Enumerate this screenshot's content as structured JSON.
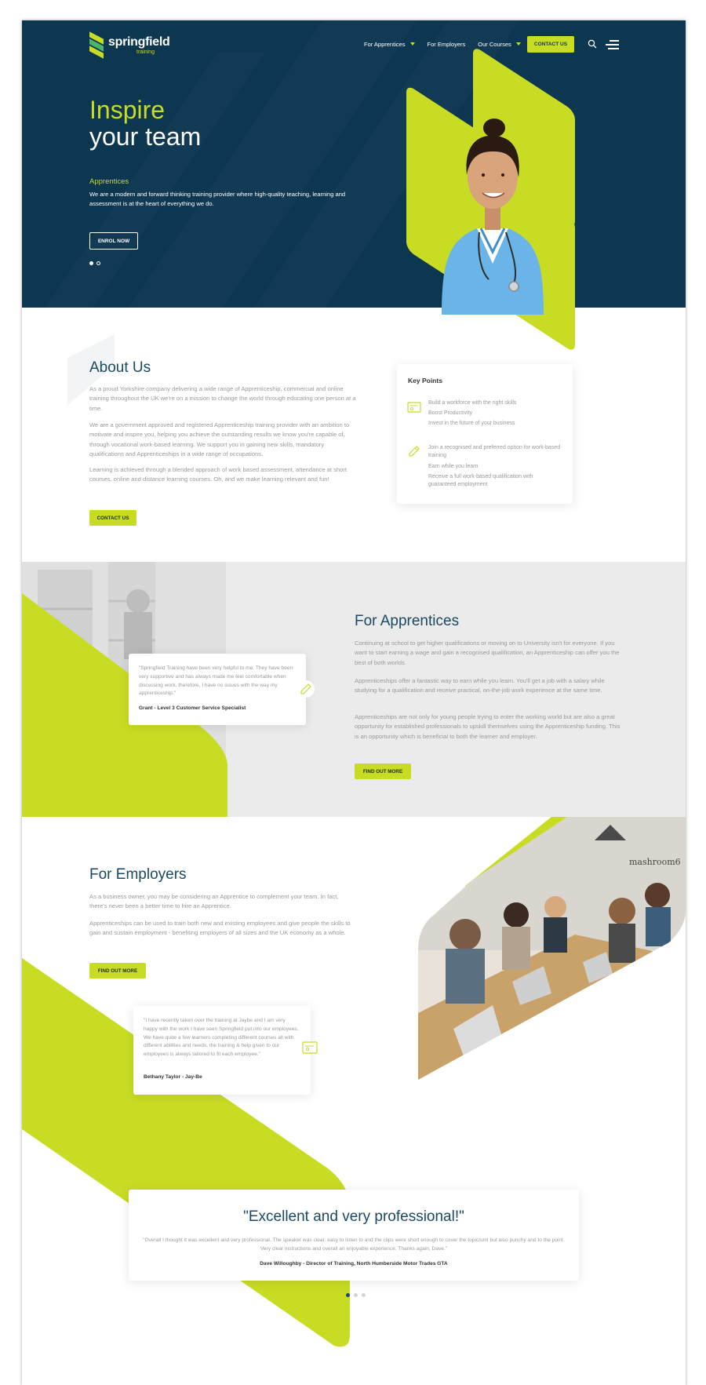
{
  "brand": {
    "name": "springfield",
    "sub": "training",
    "accent": "#c9dc24",
    "navy": "#0d3650",
    "heading": "#1a4a63"
  },
  "nav": {
    "items": [
      {
        "label": "For Apprentices",
        "dropdown": true
      },
      {
        "label": "For Employers",
        "dropdown": false
      },
      {
        "label": "Our Courses",
        "dropdown": true
      }
    ],
    "contact_label": "CONTACT US",
    "icons": [
      "search-icon",
      "menu-icon"
    ]
  },
  "hero": {
    "line1": "Inspire",
    "line2": "your team",
    "subtitle": "Apprentices",
    "description": "We are a modern and forward thinking training provider where high-quality teaching, learning and assessment is at the heart of everything we do.",
    "cta": "ENROL NOW",
    "slides": 2,
    "active_slide": 1
  },
  "about": {
    "title": "About Us",
    "p1": "As a proud Yorkshire company delivering a wide range of Apprenticeship, commercial and online training throughout the UK we're on a mission to change the world through educating one person at a time.",
    "p2": "We are a government approved and registered Apprenticeship training provider with an ambition to motivate and inspire you, helping you achieve the outstanding results we know you're capable of, through vocational work-based learning. We support you in gaining new skills, mandatory qualifications and Apprenticeships in a wide range of occupations.",
    "p3": "Learning is achieved through a blended approach of work based assessment, attendance at short courses, online and distance learning courses. Oh, and we make learning relevant and fun!",
    "cta": "CONTACT US"
  },
  "key_points": {
    "title": "Key Points",
    "group1": [
      "Build a workforce with the right skills",
      "Boost Productivity",
      "Invest in the future of your business"
    ],
    "group2": [
      "Join a recognised and preferred option for work-based training",
      "Earn while you learn",
      "Receive a full work-based qualification with guaranteed employment"
    ],
    "icons": [
      "certificate-icon",
      "pencil-icon"
    ]
  },
  "apprentices": {
    "title": "For Apprentices",
    "p1": "Continuing at school to get higher qualifications or moving on to University isn't for everyone. If you want to start earning a wage and gain a recognised qualification, an Apprenticeship can offer you the best of both worlds.",
    "p2": "Apprenticeships offer a fantastic way to earn while you learn. You'll get a job with a salary while studying for a qualification and receive practical, on-the-job work experience at the same time.",
    "p3": "Apprenticeships are not only for young people trying to enter the working world but are also a great opportunity for established professionals to upskill themselves using the Apprenticeship funding. This is an opportunity which is beneficial to both the learner and employer.",
    "cta": "FIND OUT MORE",
    "quote": "\"Springfield Training have been very helpful to me. They have been very supportive and has always made me feel comfortable when discussing work, therefore, I have no issues with the way my apprenticeship.\"",
    "quote_author": "Grant - Level 3 Customer Service Specialist"
  },
  "employers": {
    "title": "For Employers",
    "p1": "As a business owner, you may be considering an Apprentice to complement your team. In fact, there's never been a better time to hire an Apprentice.",
    "p2": "Apprenticeships can be used to train both new and existing employees and give people the skills to gain and sustain employment - benefiting employers of all sizes and the UK economy as a whole.",
    "cta": "FIND OUT MORE",
    "quote": "\"I have recently taken over the training at Jaybe and I am very happy with the work I have seen Springfield put into our employees. We have quite a few learners completing different courses all with different abilities and needs, the training & help given to our employees is always tailored to fit each employee.\"",
    "quote_author": "Bethany Taylor - Jay-Be",
    "photo_sign": "mashroom6"
  },
  "testimonial": {
    "headline": "\"Excellent and very professional!\"",
    "body": "\"Overall I thought it was excellent and very professional. The speaker was clear, easy to listen to and the clips were short enough to cover the topic/unit but also punchy and to the point. Very clear instructions and overall an enjoyable experience. Thanks again, Dave.\"",
    "author": "Dave Willoughby - Director of Training, North Humberside Motor Trades GTA",
    "slides": 3,
    "active_slide": 1
  }
}
